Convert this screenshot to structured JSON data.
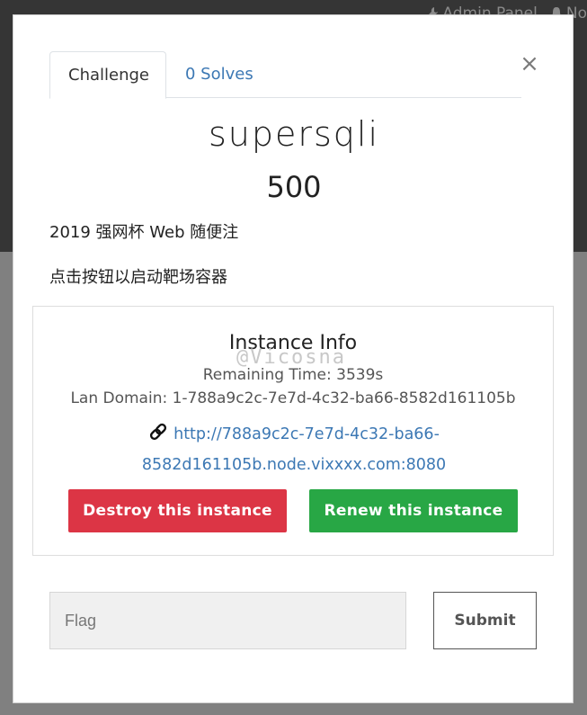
{
  "background": {
    "nav": {
      "admin_panel": "Admin Panel",
      "notifications": "No"
    }
  },
  "modal": {
    "close_label": "×",
    "tabs": [
      {
        "label": "Challenge",
        "active": true
      },
      {
        "label": "0 Solves",
        "active": false
      }
    ],
    "challenge": {
      "name": "supersqli",
      "value": "500",
      "description_line1": "2019 强网杯 Web 随便注",
      "description_line2": "点击按钮以启动靶场容器"
    },
    "instance": {
      "title": "Instance Info",
      "remaining_time": "Remaining Time: 3539s",
      "lan_domain": "Lan Domain: 1-788a9c2c-7e7d-4c32-ba66-8582d161105b",
      "link_line1": "http://788a9c2c-7e7d-4c32-ba66-",
      "link_line2": "8582d161105b.node.vixxxx.com:8080",
      "link_icon": "link-icon",
      "destroy_label": "Destroy this instance",
      "renew_label": "Renew this instance"
    },
    "watermark": "@Vicosna",
    "flag": {
      "placeholder": "Flag",
      "value": "",
      "submit_label": "Submit"
    }
  },
  "colors": {
    "danger": "#dc3545",
    "success": "#28a745",
    "link": "#3c78b4"
  }
}
